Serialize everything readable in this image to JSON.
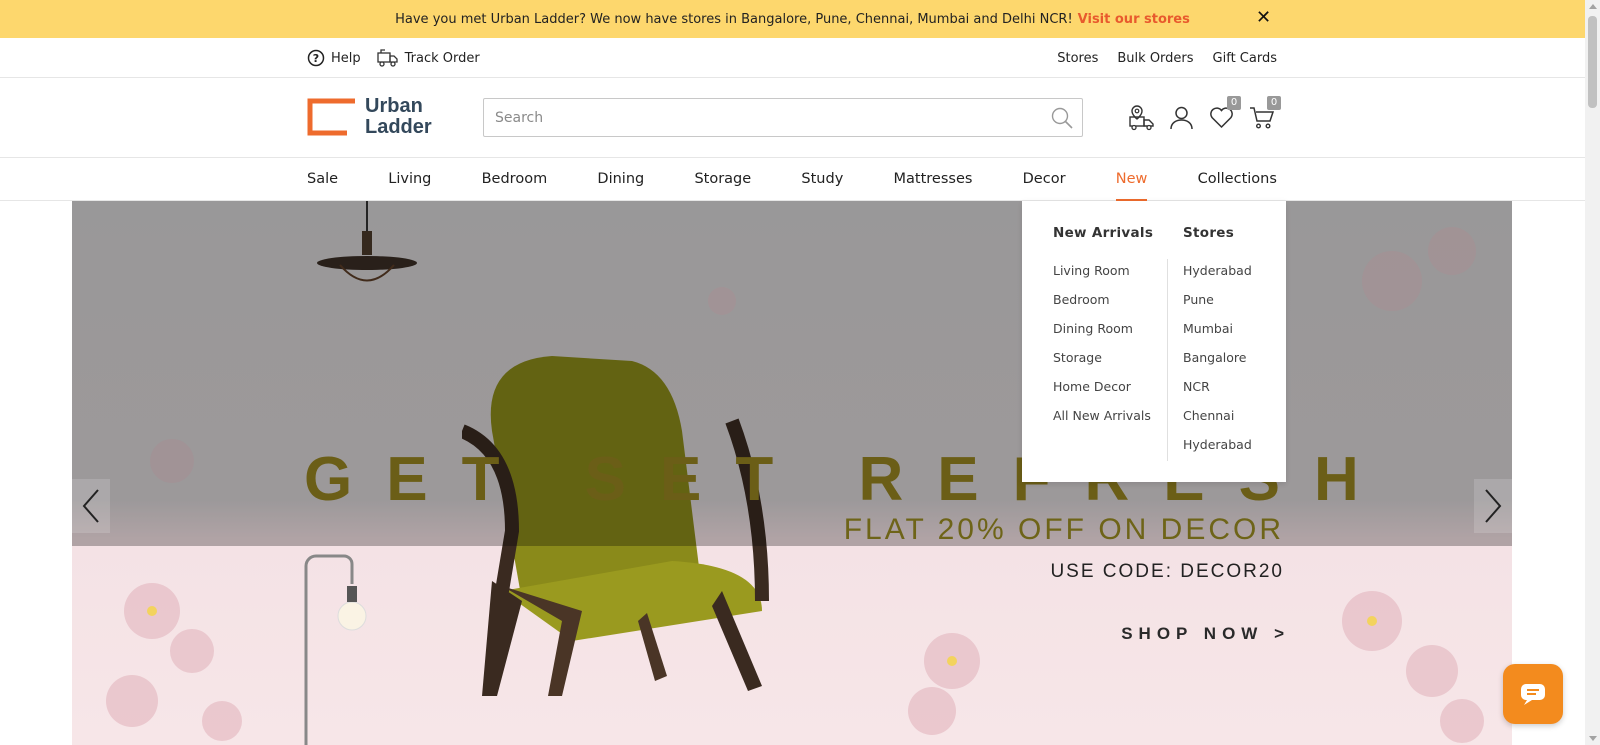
{
  "announcement": {
    "text": "Have you met Urban Ladder? We now have stores in Bangalore, Pune, Chennai, Mumbai and Delhi NCR!",
    "link": "Visit our stores",
    "close_icon": "close-icon"
  },
  "utility": {
    "help": "Help",
    "track_order": "Track Order",
    "right_links": [
      "Stores",
      "Bulk Orders",
      "Gift Cards"
    ]
  },
  "header": {
    "logo_line1": "Urban",
    "logo_line2": "Ladder",
    "search_placeholder": "Search",
    "search_value": "",
    "wishlist_count": "0",
    "cart_count": "0",
    "icons": [
      "store-locator-icon",
      "account-icon",
      "wishlist-icon",
      "cart-icon"
    ]
  },
  "nav": {
    "items": [
      "Sale",
      "Living",
      "Bedroom",
      "Dining",
      "Storage",
      "Study",
      "Mattresses",
      "Decor",
      "New",
      "Collections"
    ],
    "active": "New"
  },
  "dropdown": {
    "col1_title": "New Arrivals",
    "col1_items": [
      "Living Room",
      "Bedroom",
      "Dining Room",
      "Storage",
      "Home Decor",
      "All New Arrivals"
    ],
    "col2_title": "Stores",
    "col2_items": [
      "Hyderabad",
      "Pune",
      "Mumbai",
      "Bangalore",
      "NCR",
      "Chennai",
      "Hyderabad"
    ]
  },
  "hero": {
    "headline": "GET SET REFRESH",
    "offer": "FLAT 20% OFF ON DECOR",
    "code": "USE CODE: DECOR20",
    "cta": "SHOP NOW >"
  },
  "colors": {
    "accent": "#ee6b2d",
    "announce_bg": "#fdd76d",
    "chat_bg": "#f38b1e"
  }
}
